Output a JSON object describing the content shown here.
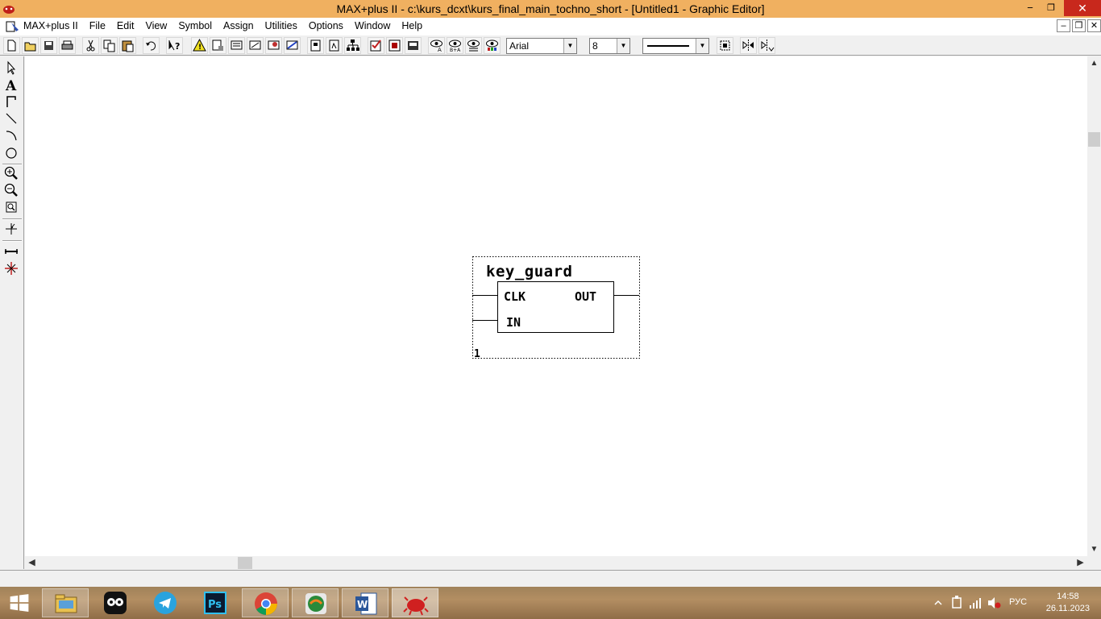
{
  "window": {
    "title": "MAX+plus II - c:\\kurs_dcxt\\kurs_final_main_tochno_short - [Untitled1 - Graphic Editor]",
    "minimize": "−",
    "maximize": "❐",
    "close": "✕"
  },
  "menu": {
    "items": [
      "MAX+plus II",
      "File",
      "Edit",
      "View",
      "Symbol",
      "Assign",
      "Utilities",
      "Options",
      "Window",
      "Help"
    ],
    "mdi_minimize": "–",
    "mdi_restore": "❐",
    "mdi_close": "✕"
  },
  "toolbar": {
    "font_value": "Arial",
    "size_value": "8"
  },
  "symbol": {
    "name": "key_guard",
    "pin_clk": "CLK",
    "pin_in": "IN",
    "pin_out": "OUT",
    "instance_number": "1"
  },
  "taskbar": {
    "language": "РУС",
    "time": "14:58",
    "date": "26.11.2023"
  }
}
